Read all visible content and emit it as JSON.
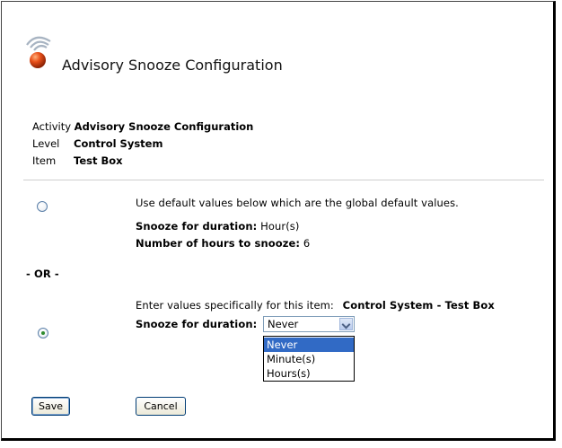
{
  "page": {
    "title": "Advisory Snooze Configuration"
  },
  "info": {
    "activity_label": "Activity",
    "activity_value": "Advisory Snooze Configuration",
    "level_label": "Level",
    "level_value": "Control System",
    "item_label": "Item",
    "item_value": "Test Box"
  },
  "option_default": {
    "description": "Use default values below which are the global default values.",
    "snooze_label": "Snooze for duration:",
    "snooze_value": "Hour(s)",
    "hours_label": "Number of hours to snooze:",
    "hours_value": "6",
    "selected": false
  },
  "separator_text": "- OR -",
  "option_specific": {
    "description": "Enter values specifically for this item:",
    "item_path": "Control System - Test Box",
    "snooze_label": "Snooze for duration:",
    "selected": true,
    "select_value": "Never",
    "options": [
      "Never",
      "Minute(s)",
      "Hours(s)"
    ],
    "highlighted_option": "Never"
  },
  "buttons": {
    "save": "Save",
    "cancel": "Cancel"
  },
  "icons": {
    "logo": "advisory-signal-icon"
  },
  "colors": {
    "selection_highlight": "#316ac5",
    "logo_orange": "#e8501a"
  }
}
